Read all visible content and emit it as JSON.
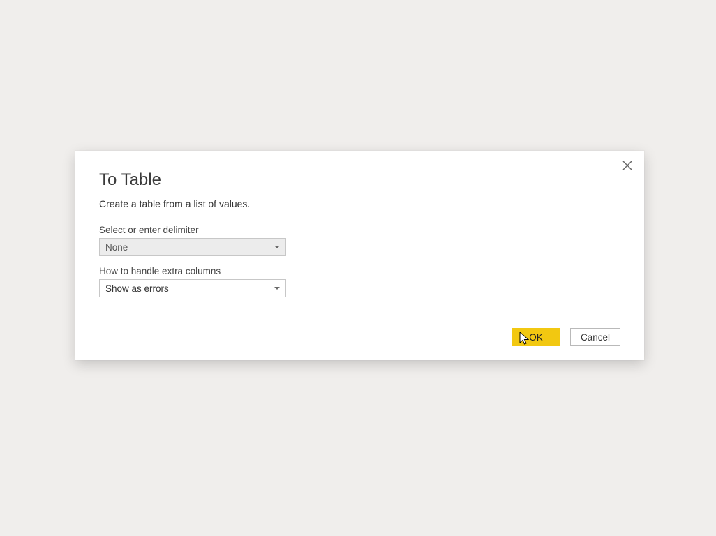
{
  "dialog": {
    "title": "To Table",
    "subtitle": "Create a table from a list of values.",
    "fields": {
      "delimiter": {
        "label": "Select or enter delimiter",
        "value": "None"
      },
      "extraColumns": {
        "label": "How to handle extra columns",
        "value": "Show as errors"
      }
    },
    "buttons": {
      "ok": "OK",
      "cancel": "Cancel"
    }
  }
}
